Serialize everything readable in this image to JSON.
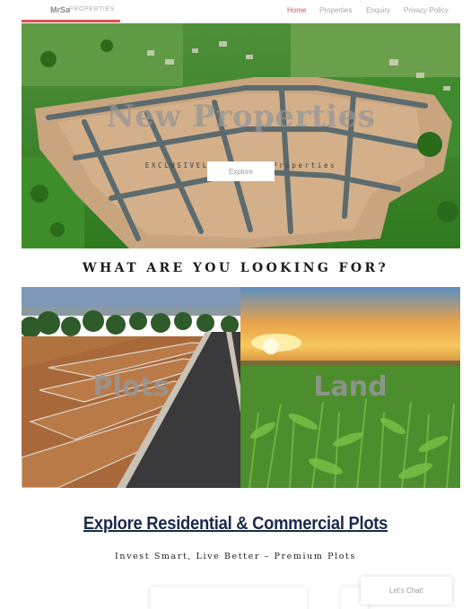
{
  "header": {
    "logo_main": "MrSa",
    "logo_sub": "PROPERTIES",
    "nav": [
      {
        "label": "Home",
        "active": true
      },
      {
        "label": "Properties",
        "active": false
      },
      {
        "label": "Enquiry",
        "active": false
      },
      {
        "label": "Privacy Policy",
        "active": false
      }
    ]
  },
  "hero": {
    "title": "New Properties",
    "subtitle": "EXCLUSIVELY BY MrSa Properties",
    "button_label": "Explore"
  },
  "section_heading": "WHAT ARE YOU LOOKING FOR?",
  "categories": [
    {
      "label": "Plots"
    },
    {
      "label": "Land"
    }
  ],
  "explore": {
    "title": "Explore Residential & Commercial Plots",
    "subtitle": "Invest Smart, Live Better – Premium Plots"
  },
  "chat": {
    "label": "Let's Chat!"
  },
  "colors": {
    "accent": "#d9534f",
    "heading_navy": "#1a2a4a",
    "nav_inactive": "#a8a8a8"
  }
}
